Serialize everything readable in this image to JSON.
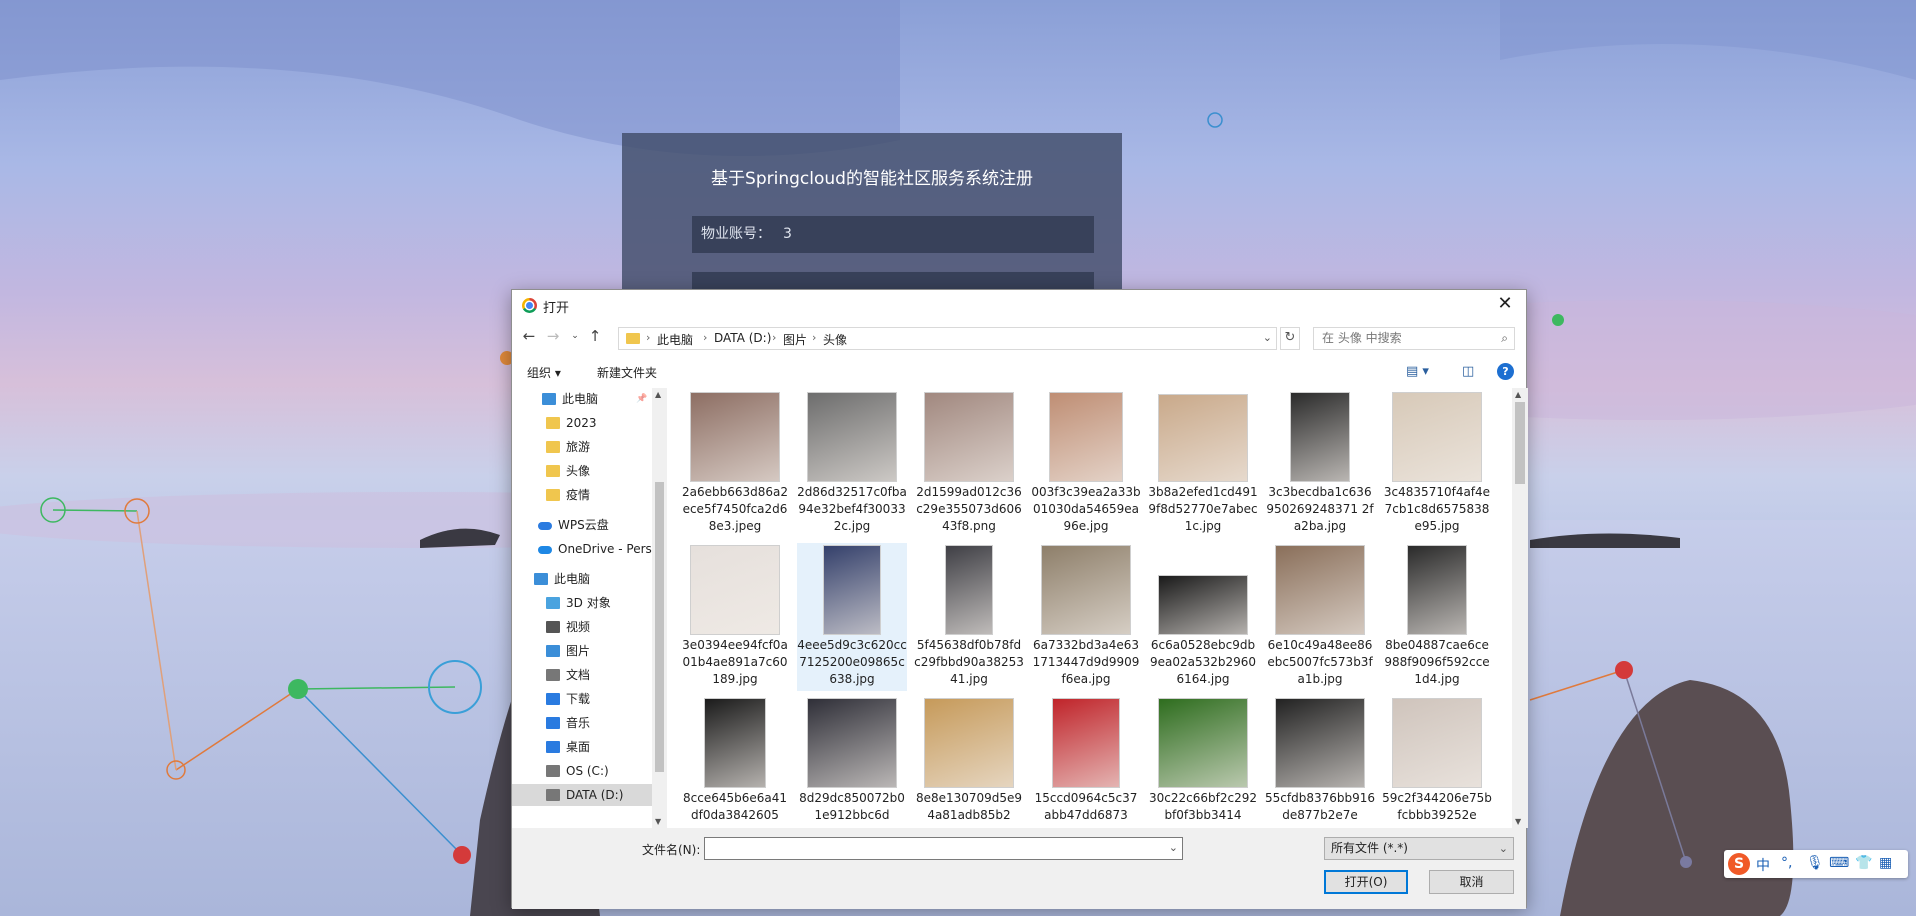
{
  "register_card": {
    "title": "基于Springcloud的智能社区服务系统注册",
    "field_label": "物业账号：",
    "field_value": "3"
  },
  "dialog": {
    "title": "打开",
    "breadcrumb": [
      "此电脑",
      "DATA (D:)",
      "图片",
      "头像"
    ],
    "search_placeholder": "在 头像 中搜索",
    "toolbar": {
      "organize": "组织",
      "new_folder": "新建文件夹"
    },
    "nav_items": [
      {
        "label": "此电脑",
        "icon": "monitor-icon"
      },
      {
        "label": "2023",
        "icon": "folder-icon"
      },
      {
        "label": "旅游",
        "icon": "folder-icon"
      },
      {
        "label": "头像",
        "icon": "folder-icon"
      },
      {
        "label": "疫情",
        "icon": "folder-icon"
      },
      {
        "label": "WPS云盘",
        "icon": "cloud-icon"
      },
      {
        "label": "OneDrive - Perso",
        "icon": "onedrive-icon"
      },
      {
        "label": "此电脑",
        "icon": "monitor-icon"
      },
      {
        "label": "3D 对象",
        "icon": "cube-icon"
      },
      {
        "label": "视频",
        "icon": "video-icon"
      },
      {
        "label": "图片",
        "icon": "picture-icon"
      },
      {
        "label": "文档",
        "icon": "document-icon"
      },
      {
        "label": "下载",
        "icon": "download-icon"
      },
      {
        "label": "音乐",
        "icon": "music-icon"
      },
      {
        "label": "桌面",
        "icon": "desktop-icon"
      },
      {
        "label": "OS (C:)",
        "icon": "drive-icon"
      },
      {
        "label": "DATA (D:)",
        "icon": "drive-icon"
      }
    ],
    "files": [
      {
        "name": "2a6ebb663d86a2ece5f7450fca2d68e3.jpeg"
      },
      {
        "name": "2d86d32517c0fba94e32bef4f300332c.jpg"
      },
      {
        "name": "2d1599ad012c36c29e355073d60643f8.png"
      },
      {
        "name": "003f3c39ea2a33b01030da54659ea96e.jpg"
      },
      {
        "name": "3b8a2efed1cd4919f8d52770e7abec1c.jpg"
      },
      {
        "name": "3c3becdba1c636950269248371 2fa2ba.jpg"
      },
      {
        "name": "3c4835710f4af4e7cb1c8d6575838e95.jpg"
      },
      {
        "name": "3e0394ee94fcf0a01b4ae891a7c60189.jpg"
      },
      {
        "name": "4eee5d9c3c620cc7125200e09865c638.jpg"
      },
      {
        "name": "5f45638df0b78fdc29fbbd90a3825341.jpg"
      },
      {
        "name": "6a7332bd3a4e631713447d9d9909f6ea.jpg"
      },
      {
        "name": "6c6a0528ebc9db9ea02a532b29606164.jpg"
      },
      {
        "name": "6e10c49a48ee86ebc5007fc573b3fa1b.jpg"
      },
      {
        "name": "8be04887cae6ce988f9096f592cce1d4.jpg"
      },
      {
        "name": "8cce645b6e6a41df0da3842605"
      },
      {
        "name": "8d29dc850072b01e912bbc6d"
      },
      {
        "name": "8e8e130709d5e94a81adb85b2"
      },
      {
        "name": "15ccd0964c5c37abb47dd6873"
      },
      {
        "name": "30c22c66bf2c292bf0f3bb3414"
      },
      {
        "name": "55cfdb8376bb916de877b2e7e"
      },
      {
        "name": "59c2f344206e75bfcbbb39252e"
      }
    ],
    "filename_label": "文件名(N):",
    "filename_value": "",
    "filetype": "所有文件 (*.*)",
    "open_button": "打开(O)",
    "cancel_button": "取消"
  },
  "ime": {
    "logo": "S",
    "mode": "中"
  }
}
